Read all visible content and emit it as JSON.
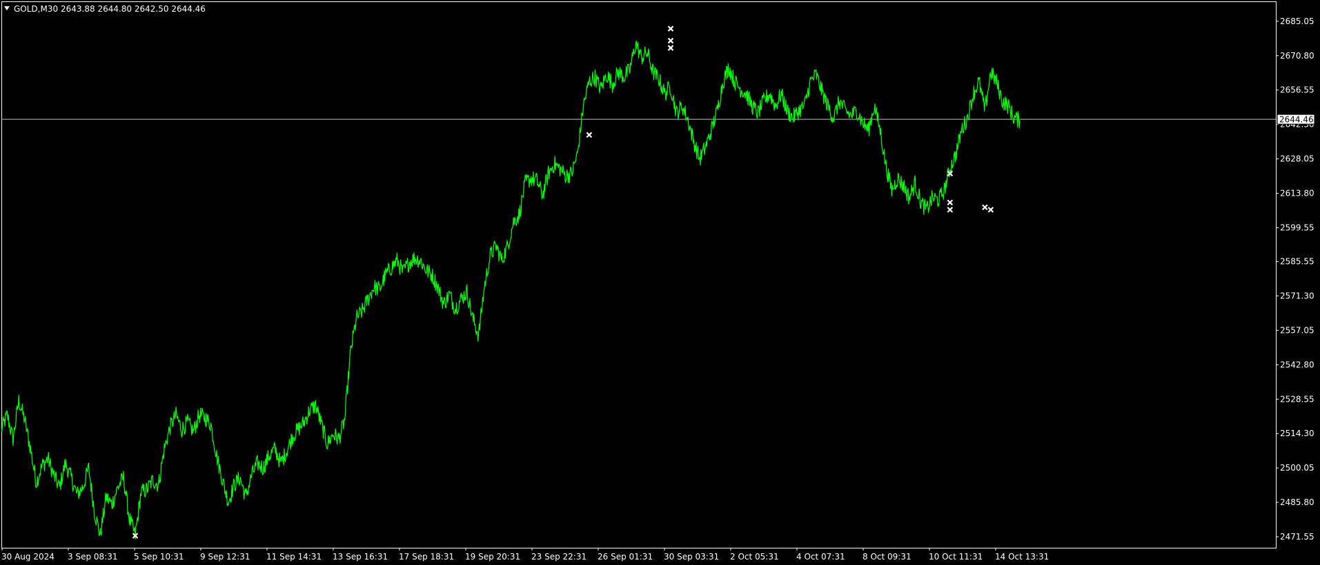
{
  "window": {
    "symbol": "GOLD,M30",
    "ohlc": "2643.88 2644.80 2642.50 2644.46"
  },
  "colors": {
    "background": "#000000",
    "price_line": "#00ff00",
    "frame": "#ffffff",
    "current_price_line": "#c0c0c0",
    "marker": "#ffffff"
  },
  "chart_data": {
    "type": "line",
    "series": [
      {
        "values": [
          2516,
          2522,
          2512,
          2528,
          2520,
          2508,
          2494,
          2501,
          2504,
          2497,
          2492,
          2502,
          2496,
          2489,
          2492,
          2500,
          2482,
          2472,
          2488,
          2485,
          2492,
          2496,
          2479,
          2472,
          2490,
          2491,
          2495,
          2493,
          2508,
          2517,
          2522,
          2516,
          2519,
          2515,
          2522,
          2521,
          2518,
          2505,
          2495,
          2486,
          2493,
          2496,
          2488,
          2497,
          2502,
          2500,
          2505,
          2508,
          2502,
          2507,
          2513,
          2516,
          2519,
          2524,
          2526,
          2518,
          2510,
          2514,
          2512,
          2520,
          2548,
          2562,
          2565,
          2570,
          2575,
          2574,
          2580,
          2583,
          2586,
          2581,
          2585,
          2587,
          2586,
          2582,
          2580,
          2575,
          2568,
          2572,
          2566,
          2570,
          2573,
          2562,
          2555,
          2575,
          2588,
          2592,
          2586,
          2592,
          2602,
          2605,
          2618,
          2620,
          2619,
          2613,
          2622,
          2626,
          2624,
          2621,
          2622,
          2630,
          2650,
          2660,
          2662,
          2657,
          2663,
          2659,
          2664,
          2662,
          2665,
          2676,
          2670,
          2672,
          2664,
          2661,
          2655,
          2658,
          2647,
          2650,
          2644,
          2635,
          2628,
          2633,
          2640,
          2648,
          2660,
          2666,
          2660,
          2657,
          2655,
          2650,
          2647,
          2652,
          2655,
          2650,
          2655,
          2648,
          2645,
          2648,
          2650,
          2660,
          2663,
          2656,
          2650,
          2645,
          2652,
          2648,
          2646,
          2648,
          2643,
          2640,
          2650,
          2640,
          2625,
          2615,
          2620,
          2617,
          2612,
          2618,
          2610,
          2607,
          2612,
          2611,
          2615,
          2624,
          2630,
          2640,
          2645,
          2655,
          2660,
          2648,
          2664,
          2660,
          2652,
          2650,
          2645,
          2644
        ]
      }
    ],
    "x": [
      "30 Aug 2024",
      "3 Sep 08:31",
      "5 Sep 10:31",
      "9 Sep 12:31",
      "11 Sep 14:31",
      "13 Sep 16:31",
      "17 Sep 18:31",
      "19 Sep 20:31",
      "23 Sep 22:31",
      "26 Sep 01:31",
      "30 Sep 03:31",
      "2 Oct 05:31",
      "4 Oct 07:31",
      "8 Oct 09:31",
      "10 Oct 11:31",
      "14 Oct 13:31"
    ],
    "y_ticks": [
      "2685.05",
      "2670.80",
      "2656.55",
      "2642.30",
      "2628.05",
      "2613.80",
      "2599.55",
      "2585.55",
      "2571.30",
      "2557.05",
      "2542.80",
      "2528.55",
      "2514.30",
      "2500.05",
      "2485.80",
      "2471.55"
    ],
    "ylim": [
      2467,
      2693
    ],
    "current_price": 2644.46,
    "current_price_label": "2644.46",
    "trade_markers": [
      {
        "index": 23,
        "price": 2472
      },
      {
        "index": 101,
        "price": 2638
      },
      {
        "index": 115,
        "price": 2682
      },
      {
        "index": 115,
        "price": 2677
      },
      {
        "index": 115,
        "price": 2674
      },
      {
        "index": 163,
        "price": 2622
      },
      {
        "index": 163,
        "price": 2610
      },
      {
        "index": 163,
        "price": 2607
      },
      {
        "index": 169,
        "price": 2608
      },
      {
        "index": 170,
        "price": 2607
      }
    ],
    "grid": false
  }
}
